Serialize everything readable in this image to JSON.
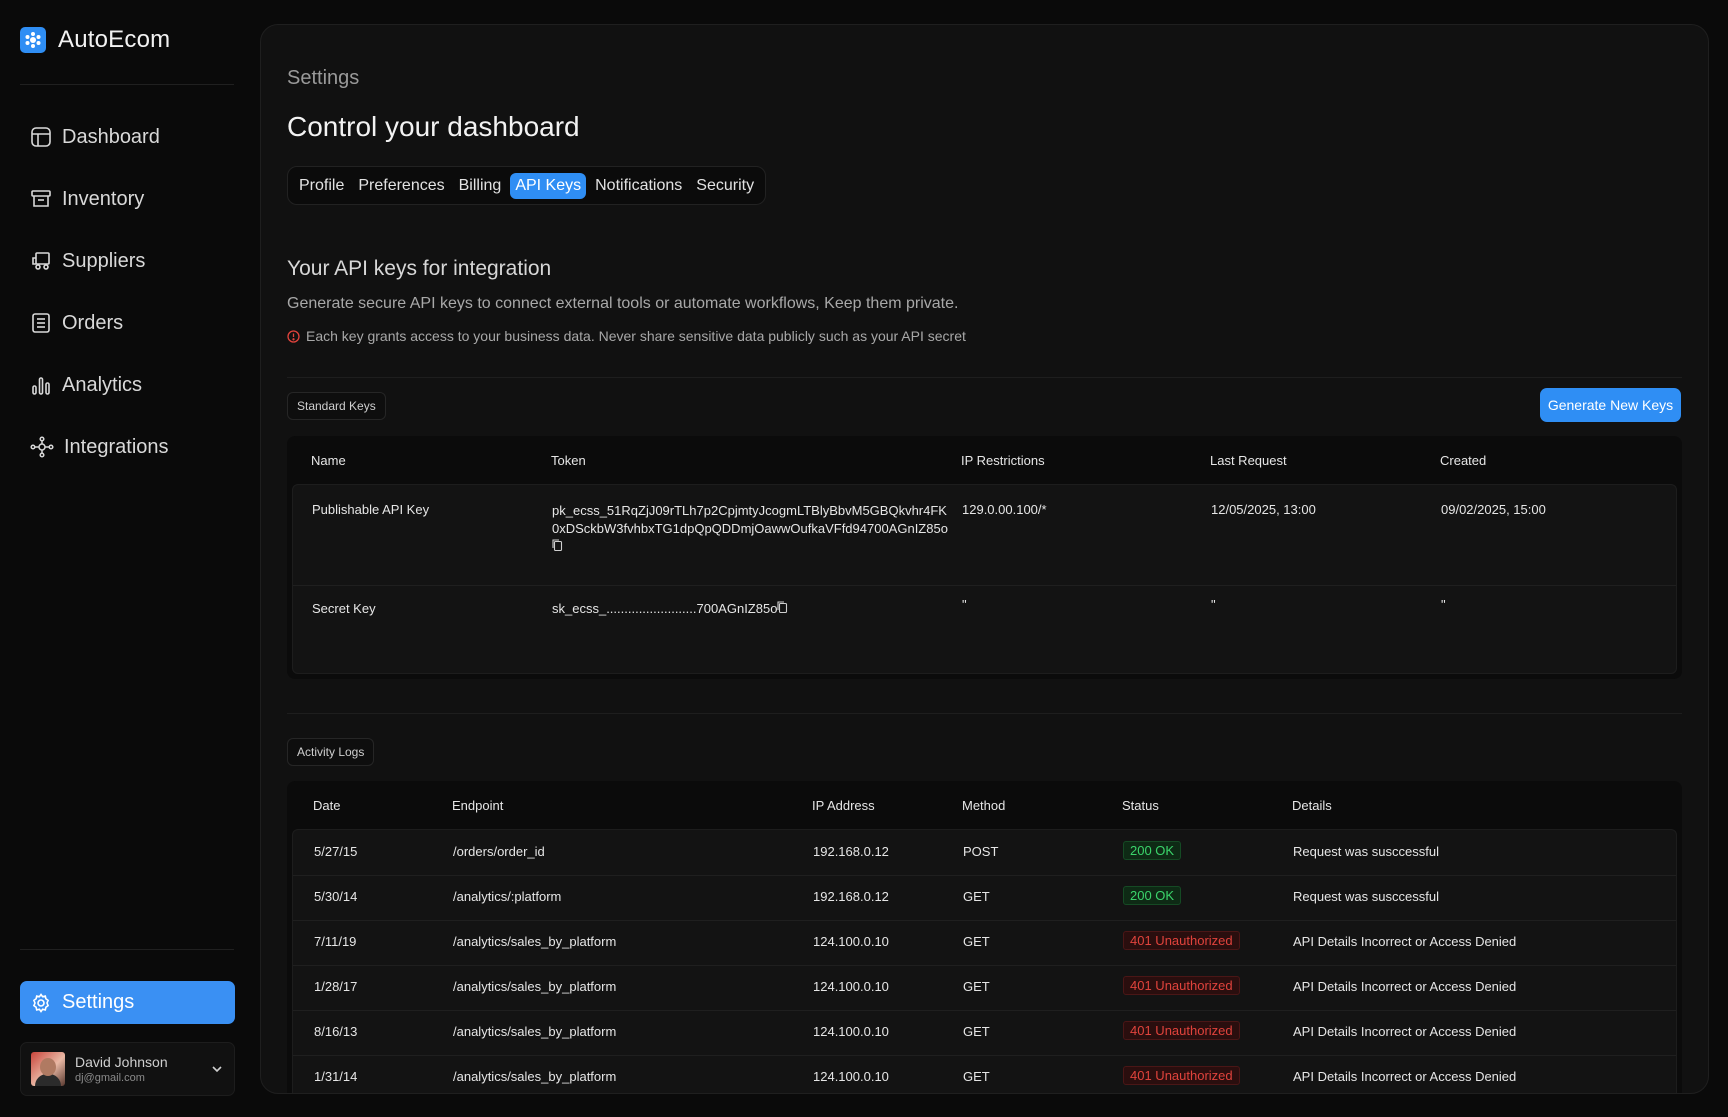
{
  "brand": {
    "name": "AutoEcom",
    "accent": "#2f8ef4"
  },
  "sidebar": {
    "items": [
      {
        "label": "Dashboard",
        "icon": "dashboard-icon"
      },
      {
        "label": "Inventory",
        "icon": "archive-box-icon"
      },
      {
        "label": "Suppliers",
        "icon": "truck-icon"
      },
      {
        "label": "Orders",
        "icon": "document-list-icon"
      },
      {
        "label": "Analytics",
        "icon": "bar-chart-icon"
      },
      {
        "label": "Integrations",
        "icon": "nodes-icon"
      }
    ],
    "settings_label": "Settings",
    "user": {
      "name": "David Johnson",
      "email": "dj@gmail.com"
    }
  },
  "header": {
    "breadcrumb": "Settings",
    "title": "Control your dashboard"
  },
  "tabs": [
    {
      "label": "Profile",
      "active": false
    },
    {
      "label": "Preferences",
      "active": false
    },
    {
      "label": "Billing",
      "active": false
    },
    {
      "label": "API Keys",
      "active": true
    },
    {
      "label": "Notifications",
      "active": false
    },
    {
      "label": "Security",
      "active": false
    }
  ],
  "api": {
    "title": "Your API keys for integration",
    "description": "Generate secure API keys to connect external tools or automate workflows, Keep them private.",
    "warning": "Each key grants access to your business data. Never share sensitive data publicly such as your API secret",
    "standard_label": "Standard Keys",
    "generate_label": "Generate New Keys",
    "columns": [
      "Name",
      "Token",
      "IP Restrictions",
      "Last Request",
      "Created"
    ],
    "keys": [
      {
        "name": "Publishable API Key",
        "token": "pk_ecss_51RqZjJ09rTLh7p2CpjmtyJcogmLTBlyBbvM5GBQkvhr4FK0xDSckbW3fvhbxTG1dpQpQDDmjOawwOufkaVFfd94700AGnIZ85o",
        "ip": "129.0.00.100/*",
        "last_request": "12/05/2025, 13:00",
        "created": "09/02/2025, 15:00"
      },
      {
        "name": "Secret Key",
        "token": "sk_ecss_.........................700AGnIZ85o",
        "ip": "\"",
        "last_request": "\"",
        "created": "\""
      }
    ]
  },
  "logs": {
    "label": "Activity Logs",
    "columns": [
      "Date",
      "Endpoint",
      "IP Address",
      "Method",
      "Status",
      "Details"
    ],
    "rows": [
      {
        "date": "5/27/15",
        "endpoint": "/orders/order_id",
        "ip": "192.168.0.12",
        "method": "POST",
        "status": "200 OK",
        "ok": true,
        "details": "Request was susccessful"
      },
      {
        "date": "5/30/14",
        "endpoint": "/analytics/:platform",
        "ip": "192.168.0.12",
        "method": "GET",
        "status": "200 OK",
        "ok": true,
        "details": "Request was susccessful"
      },
      {
        "date": "7/11/19",
        "endpoint": "/analytics/sales_by_platform",
        "ip": "124.100.0.10",
        "method": "GET",
        "status": "401 Unauthorized",
        "ok": false,
        "details": "API Details Incorrect or Access Denied"
      },
      {
        "date": "1/28/17",
        "endpoint": "/analytics/sales_by_platform",
        "ip": "124.100.0.10",
        "method": "GET",
        "status": "401 Unauthorized",
        "ok": false,
        "details": "API Details Incorrect or Access Denied"
      },
      {
        "date": "8/16/13",
        "endpoint": "/analytics/sales_by_platform",
        "ip": "124.100.0.10",
        "method": "GET",
        "status": "401 Unauthorized",
        "ok": false,
        "details": "API Details Incorrect or Access Denied"
      },
      {
        "date": "1/31/14",
        "endpoint": "/analytics/sales_by_platform",
        "ip": "124.100.0.10",
        "method": "GET",
        "status": "401 Unauthorized",
        "ok": false,
        "details": "API Details Incorrect or Access Denied"
      }
    ]
  },
  "colors": {
    "success": "#3bd46b",
    "error": "#e0433c",
    "warning_icon": "#e0433c"
  }
}
